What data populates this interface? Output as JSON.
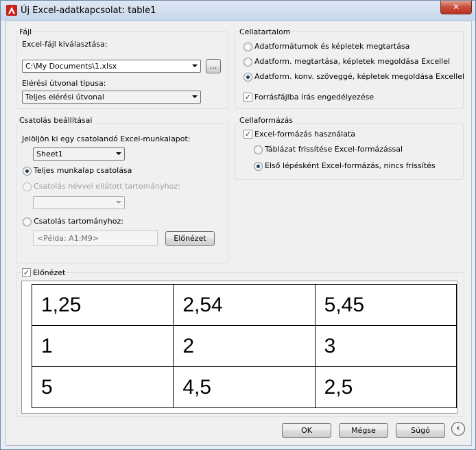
{
  "window": {
    "title": "Új Excel-adatkapcsolat: table1",
    "close_label": "✕"
  },
  "file_group": {
    "title": "Fájl",
    "choose_label": "Excel-fájl kiválasztása:",
    "file_value": "C:\\My Documents\\1.xlsx",
    "browse_label": "...",
    "path_type_label": "Elérési útvonal típusa:",
    "path_type_value": "Teljes elérési útvonal"
  },
  "link_group": {
    "title": "Csatolás beállításai",
    "sheet_prompt": "Jelöljön ki egy csatolandó Excel-munkalapot:",
    "sheet_value": "Sheet1",
    "opt_full_sheet": "Teljes munkalap csatolása",
    "opt_named_range": "Csatolás névvel ellátott tartományhoz:",
    "named_range_value": "",
    "opt_range": "Csatolás tartományhoz:",
    "range_placeholder": "<Példa: A1:M9>",
    "preview_button": "Előnézet"
  },
  "cell_content": {
    "title": "Cellatartalom",
    "opt1": "Adatformátumok és képletek megtartása",
    "opt2": "Adatform. megtartása, képletek megoldása Excellel",
    "opt3": "Adatform. konv. szöveggé, képletek megoldása Excellel",
    "allow_write": "Forrásfájlba írás engedélyezése"
  },
  "cell_format": {
    "title": "Cellaformázás",
    "use_excel": "Excel-formázás használata",
    "opt_refresh": "Táblázat frissítése Excel-formázással",
    "opt_first": "Első lépésként Excel-formázás, nincs frissítés"
  },
  "preview": {
    "label": "Előnézet",
    "rows": [
      [
        "1,25",
        "2,54",
        "5,45"
      ],
      [
        "1",
        "2",
        "3"
      ],
      [
        "5",
        "4,5",
        "2,5"
      ]
    ]
  },
  "footer": {
    "ok": "OK",
    "cancel": "Mégse",
    "help": "Súgó"
  }
}
